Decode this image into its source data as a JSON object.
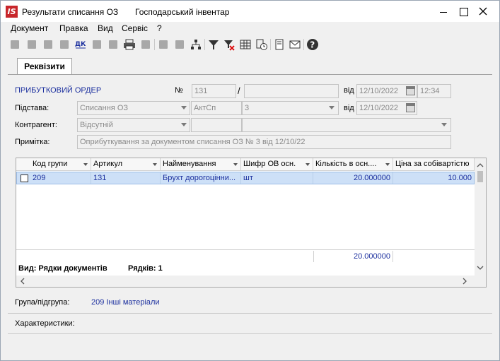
{
  "window": {
    "logo": "IS",
    "title": "Результати списання ОЗ",
    "subtitle": "Господарський інвентар"
  },
  "menu": [
    "Документ",
    "Правка",
    "Вид",
    "Сервіс",
    "?"
  ],
  "tab": {
    "label": "Реквізити"
  },
  "form": {
    "doc_type": "ПРИБУТКОВИЙ ОРДЕР",
    "number_label": "№",
    "number_value": "131",
    "slash": "/",
    "number_suffix": "",
    "date_label": "від",
    "date_value": "12/10/2022",
    "time_value": "12:34",
    "basis_label": "Підстава:",
    "basis_value": "Списання ОЗ",
    "basis_code": "АктСп",
    "basis_number": "3",
    "basis_date_label": "від",
    "basis_date": "12/10/2022",
    "counterparty_label": "Контрагент:",
    "counterparty_value": "Відсутній",
    "note_label": "Примітка:",
    "note_value": "Оприбуткування за документом списання ОЗ № 3 від 12/10/22"
  },
  "grid": {
    "columns": [
      "Код групи",
      "Артикул",
      "Найменування",
      "Шифр ОВ осн.",
      "Кількість в осн....",
      "Ціна за собівартістю"
    ],
    "rows": [
      {
        "group": "209",
        "article": "131",
        "name": "Брухт дорогоцінни...",
        "unit": "шт",
        "qty": "20.000000",
        "price": "10.000"
      }
    ],
    "total_qty": "20.000000",
    "view_label": "Вид: Рядки документів",
    "rows_label": "Рядків: 1"
  },
  "footer": {
    "group_label": "Група/підгрупа:",
    "group_value": "209 Інші матеріали",
    "chars_label": "Характеристики:"
  },
  "colors": {
    "accent": "#1b2f9e",
    "selection": "#cde0f7",
    "logo": "#c8262b"
  }
}
